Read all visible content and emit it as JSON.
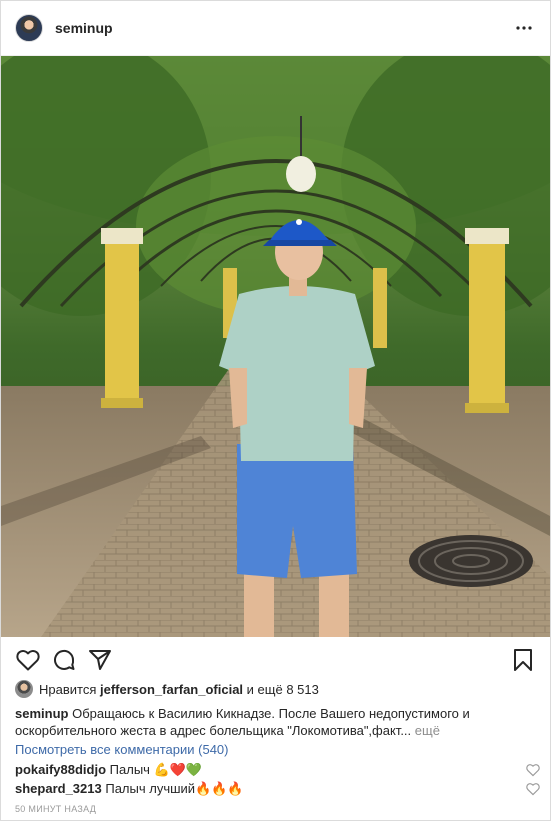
{
  "header": {
    "username": "seminup"
  },
  "photo": {
    "alt": "Man in blue cap and light green polo standing under a green pergola"
  },
  "likes": {
    "prefix": "Нравится",
    "liker": "jefferson_farfan_oficial",
    "suffix": "и ещё 8 513"
  },
  "caption": {
    "username": "seminup",
    "text": "Обращаюсь к Василию Кикнадзе. После Вашего недопустимого и оскорбительного жеста в адрес болельщика \"Локомотива\",факт...",
    "more": "ещё"
  },
  "view_all_comments": "Посмотреть все комментарии (540)",
  "comments": [
    {
      "username": "pokaify88didjo",
      "text": "Палыч 💪❤️💚"
    },
    {
      "username": "shepard_3213",
      "text": "Палыч лучший🔥🔥🔥"
    }
  ],
  "timestamp": "50 МИНУТ НАЗАД",
  "icons": {
    "more": "more-options-icon",
    "like": "heart-icon",
    "comment": "comment-icon",
    "share": "share-icon",
    "save": "bookmark-icon"
  }
}
